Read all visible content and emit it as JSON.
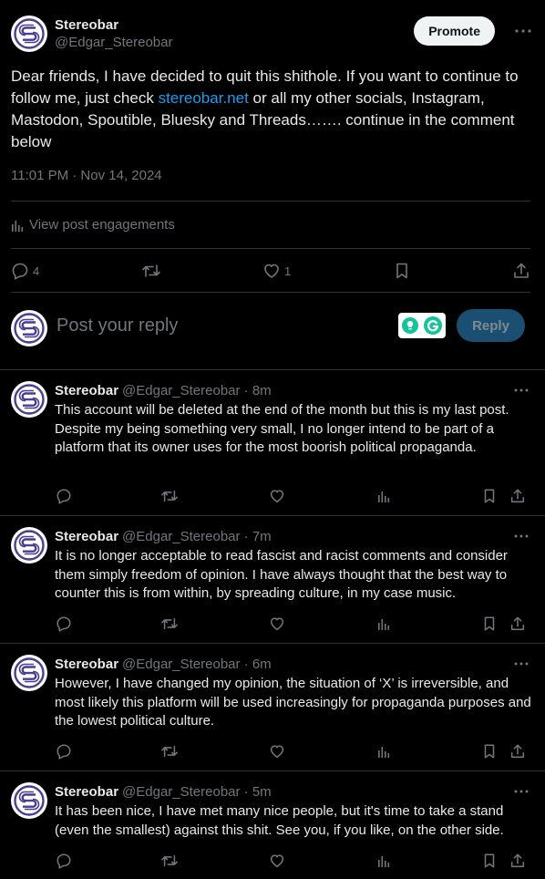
{
  "main_post": {
    "author_name": "Stereobar",
    "author_handle": "@Edgar_Stereobar",
    "promote_label": "Promote",
    "text_before_link": "Dear friends, I have decided to quit this shithole. If you want to continue to follow me, just check ",
    "link_text": "stereobar.net",
    "text_after_link": " or all my other socials, Instagram, Mastodon, Spoutible, Bluesky and Threads……. continue in the comment below",
    "timestamp": "11:01 PM · Nov 14, 2024",
    "engagements_label": "View post engagements",
    "reply_count": "4",
    "like_count": "1"
  },
  "reply_box": {
    "placeholder": "Post your reply",
    "reply_button_label": "Reply"
  },
  "replies": [
    {
      "author_name": "Stereobar",
      "author_meta": "@Edgar_Stereobar · 8m",
      "text": "This account will be deleted at the end of the month but this is my last post.\nDespite my being something very small, I no longer intend to be part of a platform that its owner uses for the most boorish political propaganda."
    },
    {
      "author_name": "Stereobar",
      "author_meta": "@Edgar_Stereobar · 7m",
      "text": "It is no longer acceptable to read fascist and racist comments and consider them simply freedom of opinion. I have always thought that the best way to counter this is from within, by spreading culture, in my case music."
    },
    {
      "author_name": "Stereobar",
      "author_meta": "@Edgar_Stereobar · 6m",
      "text": "However, I have changed my opinion, the situation of ‘X’ is irreversible, and most likely this platform will be used increasingly for propaganda purposes and the lowest political culture."
    },
    {
      "author_name": "Stereobar",
      "author_meta": "@Edgar_Stereobar · 5m",
      "text": "It has been nice, I have met many nice people, but it's time to take a stand (even the smallest) against this shit. See you, if you like, on the other side."
    }
  ],
  "colors": {
    "background": "#000000",
    "text": "#e7e9ea",
    "muted": "#71767b",
    "link": "#1d9bf0",
    "divider": "#2f3336",
    "reply_button_disabled": "#1a4f72",
    "avatar_logo": "#4b3d8f"
  },
  "icons": [
    "stereobar-logo-icon",
    "more-icon",
    "analytics-icon",
    "reply-icon",
    "repost-icon",
    "like-icon",
    "bookmark-icon",
    "share-icon",
    "idea-extension-icon",
    "grammarly-icon"
  ]
}
